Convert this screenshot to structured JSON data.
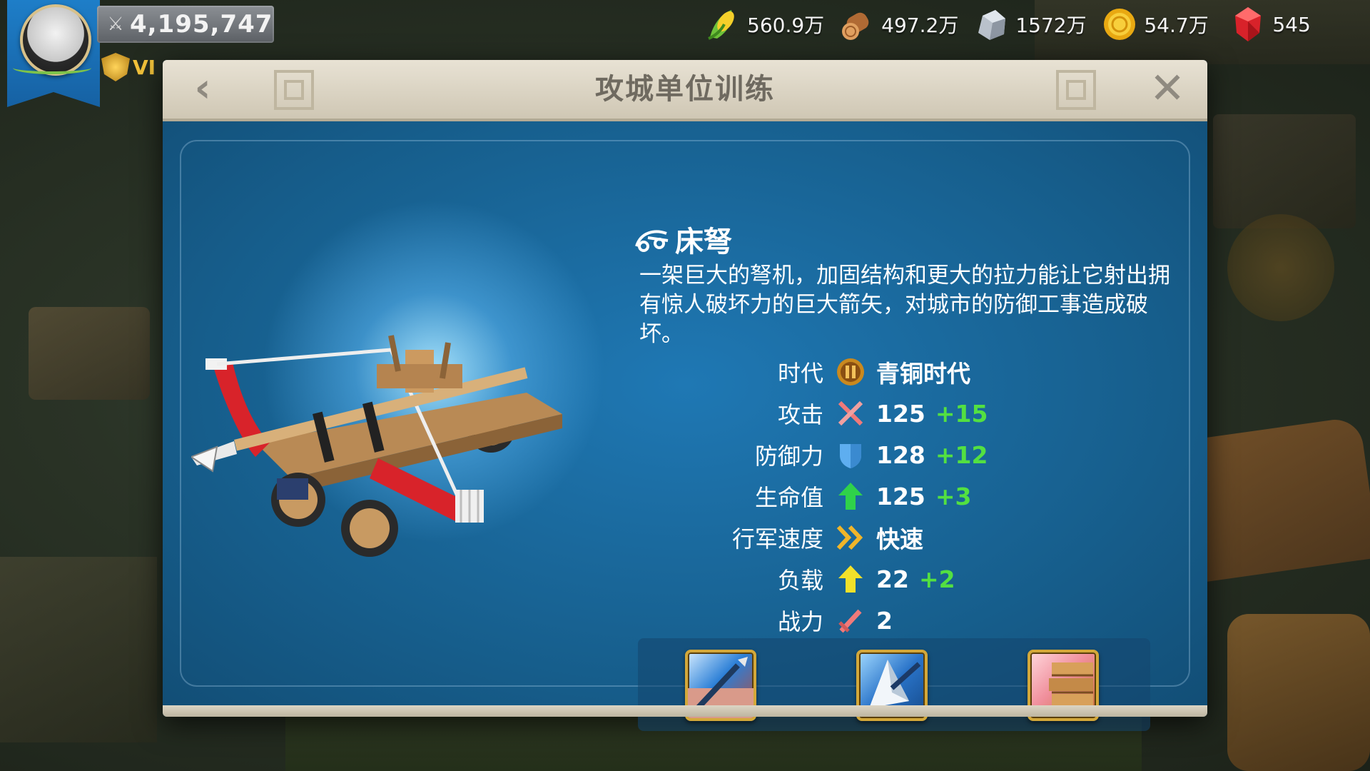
{
  "hud": {
    "power": "4,195,747",
    "vip_label": "VI",
    "resources": [
      {
        "icon": "corn-icon",
        "value": "560.9万"
      },
      {
        "icon": "wood-icon",
        "value": "497.2万"
      },
      {
        "icon": "stone-icon",
        "value": "1572万"
      },
      {
        "icon": "gold-coin-icon",
        "value": "54.7万"
      },
      {
        "icon": "gem-icon",
        "value": "545"
      }
    ]
  },
  "modal": {
    "title": "攻城单位训练"
  },
  "unit": {
    "name": "床弩",
    "description": "一架巨大的弩机，加固结构和更大的拉力能让它射出拥有惊人破坏力的巨大箭矢，对城市的防御工事造成破坏。",
    "stats": [
      {
        "label": "时代",
        "icon": "bronze-age-icon",
        "value": "青铜时代",
        "bonus": ""
      },
      {
        "label": "攻击",
        "icon": "attack-swords-icon",
        "value": "125",
        "bonus": "+15"
      },
      {
        "label": "防御力",
        "icon": "defense-shield-icon",
        "value": "128",
        "bonus": "+12"
      },
      {
        "label": "生命值",
        "icon": "health-arrow-icon",
        "value": "125",
        "bonus": "+3"
      },
      {
        "label": "行军速度",
        "icon": "speed-chevrons-icon",
        "value": "快速",
        "bonus": ""
      },
      {
        "label": "负载",
        "icon": "load-arrow-icon",
        "value": "22",
        "bonus": "+2"
      },
      {
        "label": "战力",
        "icon": "power-sword-icon",
        "value": "2",
        "bonus": ""
      }
    ]
  },
  "colors": {
    "bonus": "#53e041",
    "panel": "#1a5e8e",
    "header": "#e8e2d4"
  }
}
